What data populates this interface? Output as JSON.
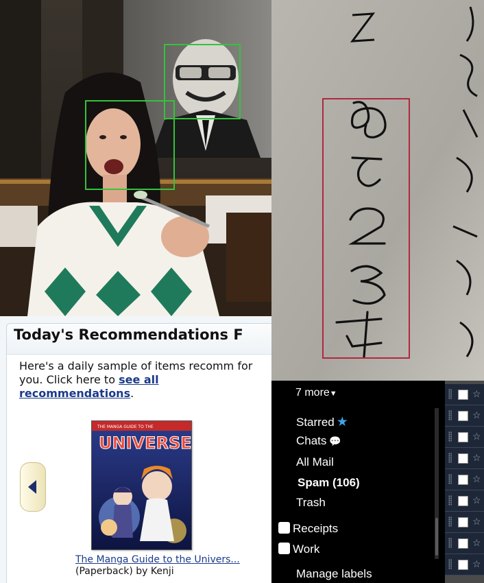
{
  "recommendations": {
    "title": "Today's Recommendations F",
    "intro_text": "Here's a daily sample of items recomm for you. Click here to",
    "see_all_link": "see all recommendations",
    "period": ".",
    "book": {
      "title_link": "The Manga Guide to the Univers...",
      "details": "(Paperback) by Kenji",
      "cover_banner": "THE MANGA GUIDE TO THE",
      "cover_title": "UNIVERSE"
    }
  },
  "handwriting": {
    "digits": "85234"
  },
  "gmail": {
    "more": "7 more",
    "nav_items": [
      {
        "label": "Starred",
        "icon": "star-icon"
      },
      {
        "label": "Chats",
        "icon": "chat-bubble-icon"
      },
      {
        "label": "All Mail"
      },
      {
        "label": "Spam (106)"
      },
      {
        "label": "Trash"
      }
    ],
    "labels": [
      "Receipts",
      "Work"
    ],
    "manage_labels": "Manage labels"
  },
  "colors": {
    "face_box": "#33c43a",
    "digit_box": "#b0283f",
    "amazon_link": "#1a3a8a",
    "gmail_star": "#3ea3e8"
  }
}
